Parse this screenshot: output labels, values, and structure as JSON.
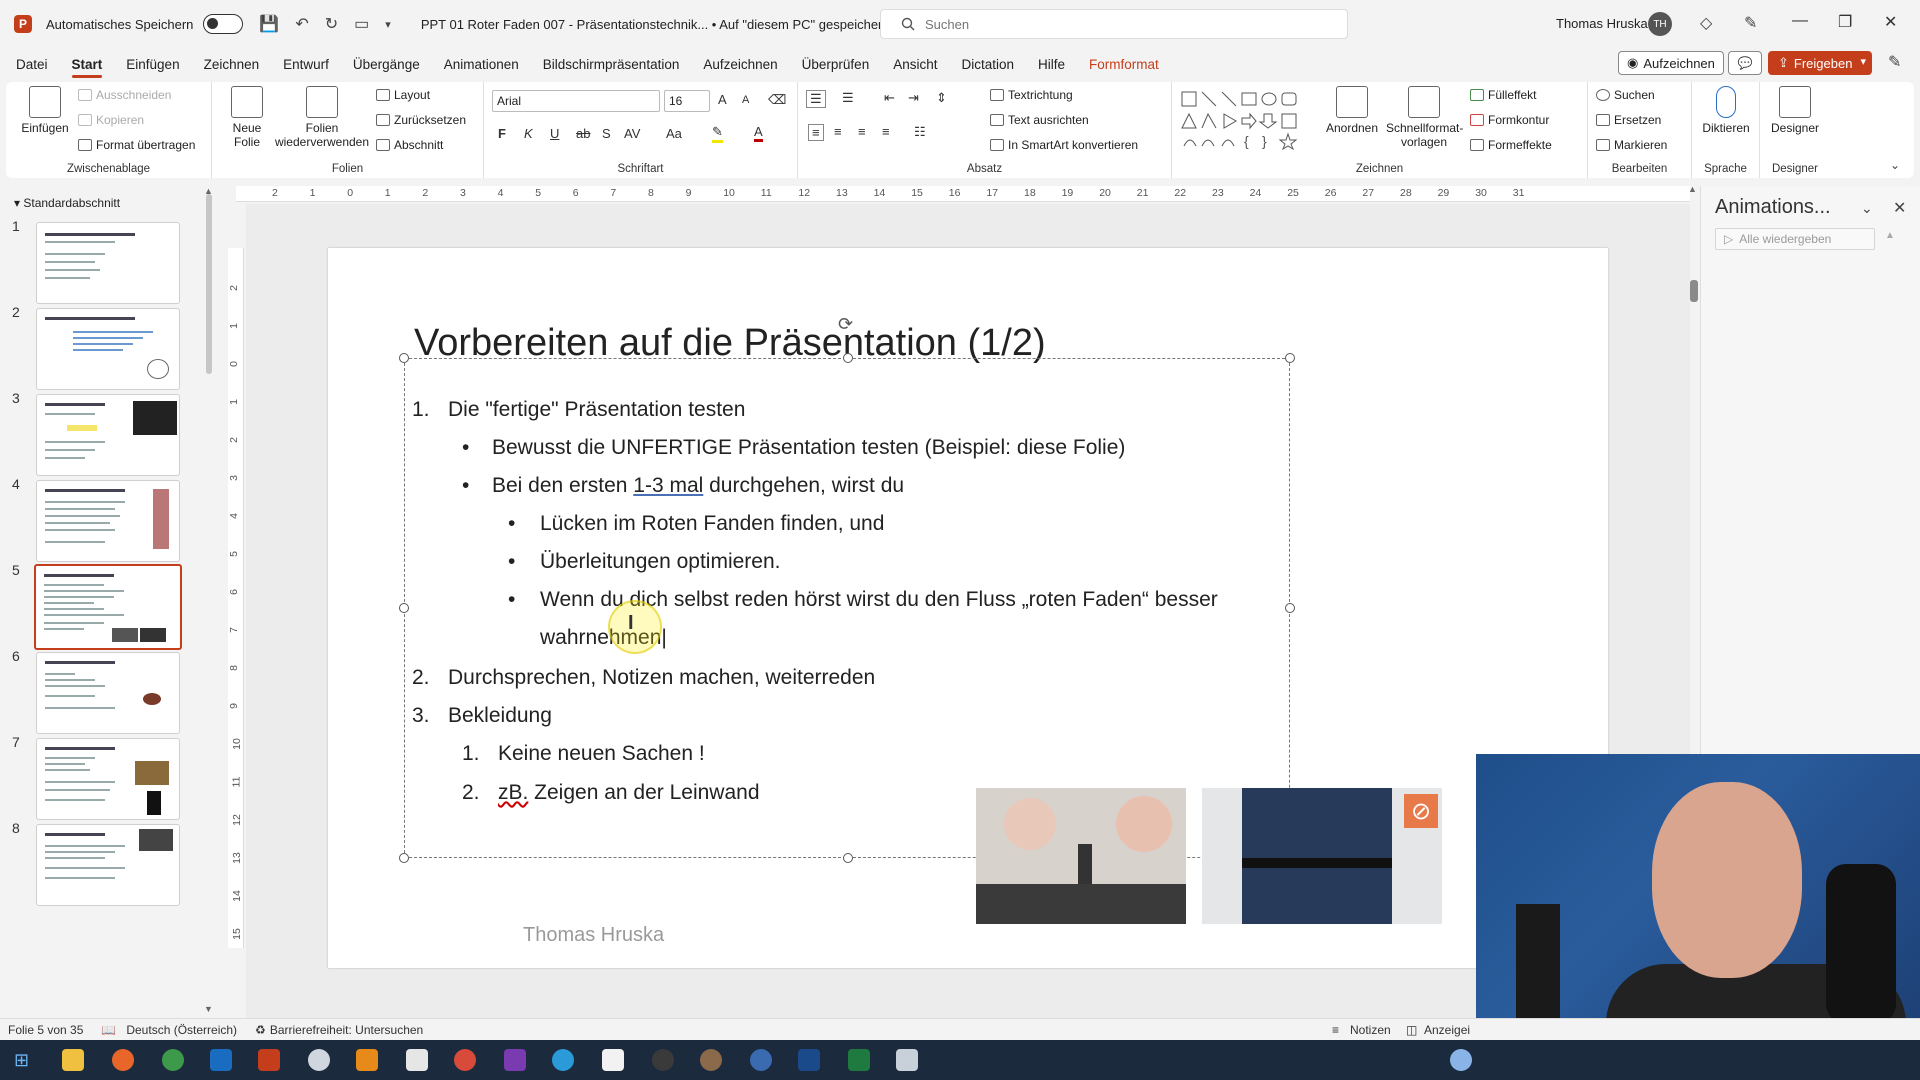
{
  "titlebar": {
    "autosave_label": "Automatisches Speichern",
    "doc_title": "PPT 01 Roter Faden 007 - Präsentationstechnik...  •  Auf \"diesem PC\" gespeichert",
    "search_placeholder": "Suchen",
    "user_name": "Thomas Hruska",
    "user_initials": "TH"
  },
  "menu": {
    "tabs": [
      "Datei",
      "Start",
      "Einfügen",
      "Zeichnen",
      "Entwurf",
      "Übergänge",
      "Animationen",
      "Bildschirmpräsentation",
      "Aufzeichnen",
      "Überprüfen",
      "Ansicht",
      "Dictation",
      "Hilfe",
      "Formformat"
    ],
    "active": "Start",
    "record_label": "Aufzeichnen",
    "share_label": "Freigeben"
  },
  "ribbon": {
    "clipboard": {
      "paste": "Einfügen",
      "cut": "Ausschneiden",
      "copy": "Kopieren",
      "format_painter": "Format übertragen",
      "label": "Zwischenablage"
    },
    "slides": {
      "new_slide": "Neue",
      "new_slide2": "Folie",
      "reuse": "Folien",
      "reuse2": "wiederverwenden",
      "layout": "Layout",
      "reset": "Zurücksetzen",
      "section": "Abschnitt",
      "label": "Folien"
    },
    "font": {
      "family": "Arial",
      "size": "16",
      "label": "Schriftart",
      "bold": "F",
      "italic": "K",
      "underline": "U",
      "strike": "ab",
      "shadow": "S",
      "spacing": "AV",
      "case": "Aa",
      "grow": "A",
      "shrink": "A"
    },
    "paragraph": {
      "text_direction": "Textrichtung",
      "align_text": "Text ausrichten",
      "smartart": "In SmartArt konvertieren",
      "label": "Absatz"
    },
    "drawing": {
      "arrange": "Anordnen",
      "quick_styles": "Schnellformat-",
      "quick_styles2": "vorlagen",
      "fill": "Fülleffekt",
      "outline": "Formkontur",
      "effects": "Formeffekte",
      "label": "Zeichnen"
    },
    "editing": {
      "find": "Suchen",
      "replace": "Ersetzen",
      "select": "Markieren",
      "label": "Bearbeiten"
    },
    "voice": {
      "dictate": "Diktieren",
      "label": "Sprache"
    },
    "designer": {
      "designer": "Designer",
      "label": "Designer"
    }
  },
  "slide_panel": {
    "section": "Standardabschnitt",
    "slides": [
      "1",
      "2",
      "3",
      "4",
      "5",
      "6",
      "7",
      "8"
    ],
    "active_index": 4
  },
  "ruler": {
    "h_ticks": [
      "2",
      "1",
      "0",
      "1",
      "2",
      "3",
      "4",
      "5",
      "6",
      "7",
      "8",
      "9",
      "10",
      "11",
      "12",
      "13",
      "14",
      "15",
      "16",
      "17",
      "18",
      "19",
      "20",
      "21",
      "22",
      "23",
      "24",
      "25",
      "26",
      "27",
      "28",
      "29",
      "30",
      "31"
    ],
    "v_ticks": [
      "2",
      "1",
      "0",
      "1",
      "2",
      "3",
      "4",
      "5",
      "6",
      "7",
      "8",
      "9",
      "10",
      "11",
      "12",
      "13",
      "14",
      "15"
    ]
  },
  "slide": {
    "title": "Vorbereiten auf die Präsentation (1/2)",
    "l1_num": "1.",
    "l1": "Die \"fertige\" Präsentation testen",
    "l1a": "Bewusst die UNFERTIGE Präsentation testen (Beispiel: diese Folie)",
    "l1b_pre": "Bei den ersten ",
    "l1b_link": "1-3 mal",
    "l1b_post": " durchgehen, wirst du",
    "l1b1": "Lücken im Roten Fanden finden, und",
    "l1b2": "Überleitungen optimieren.",
    "l1b3": "Wenn du dich selbst reden hörst wirst du den Fluss „roten Faden“ besser",
    "l1b3_cont": "wahrnehmen",
    "l2_num": "2.",
    "l2": "Durchsprechen, Notizen machen, weiterreden",
    "l3_num": "3.",
    "l3": "Bekleidung",
    "l3a_num": "1.",
    "l3a": "Keine neuen Sachen !",
    "l3b_num": "2.",
    "l3b_red": "zB.",
    "l3b_rest": " Zeigen an der Leinwand",
    "footer": "Thomas Hruska",
    "bullet": "•"
  },
  "anim_pane": {
    "title": "Animations...",
    "play_all": "Alle wiedergeben"
  },
  "status": {
    "slide_of": "Folie 5 von 35",
    "language": "Deutsch (Österreich)",
    "accessibility": "Barrierefreiheit: Untersuchen",
    "notes": "Notizen",
    "display": "Anzeigei"
  },
  "colors": {
    "accent": "#c43e1c",
    "taskbar": "#1b2a3d"
  }
}
